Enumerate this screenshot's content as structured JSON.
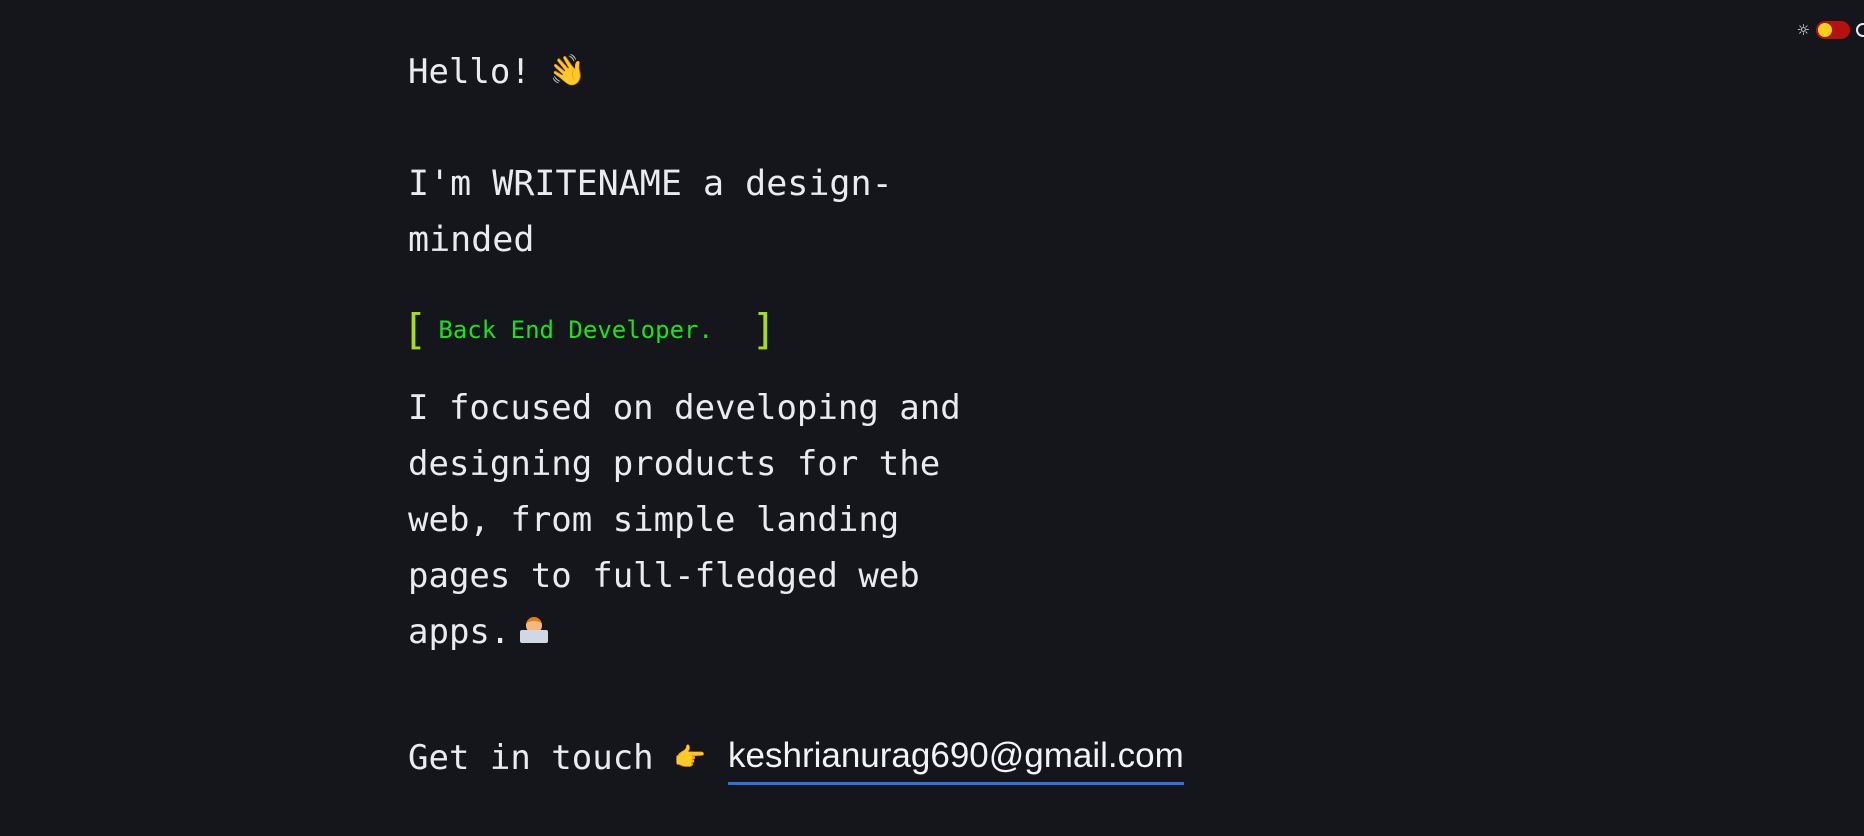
{
  "header": {
    "theme_toggle": {
      "sun_glyph": "☼",
      "state": "light-off",
      "track_color": "#b4120f",
      "knob_color": "#f2cf18"
    }
  },
  "hero": {
    "greeting": "Hello!",
    "wave_emoji": "👋",
    "intro": "I'm WRITENAME a design-minded",
    "role": {
      "bracket_open": "[",
      "text": "Back End Developer.",
      "bracket_close": "]",
      "text_color": "#19e41b",
      "bracket_color": "#a2e019"
    },
    "about": "I focused on developing and designing products for the web, from simple landing pages to full-fledged web apps.",
    "contact": {
      "label": "Get in touch",
      "pointer_emoji": "👉",
      "email": "keshrianurag690@gmail.com",
      "underline_color": "#2a73d9"
    }
  },
  "colors": {
    "background": "#14161b",
    "text": "#e9ebee"
  }
}
